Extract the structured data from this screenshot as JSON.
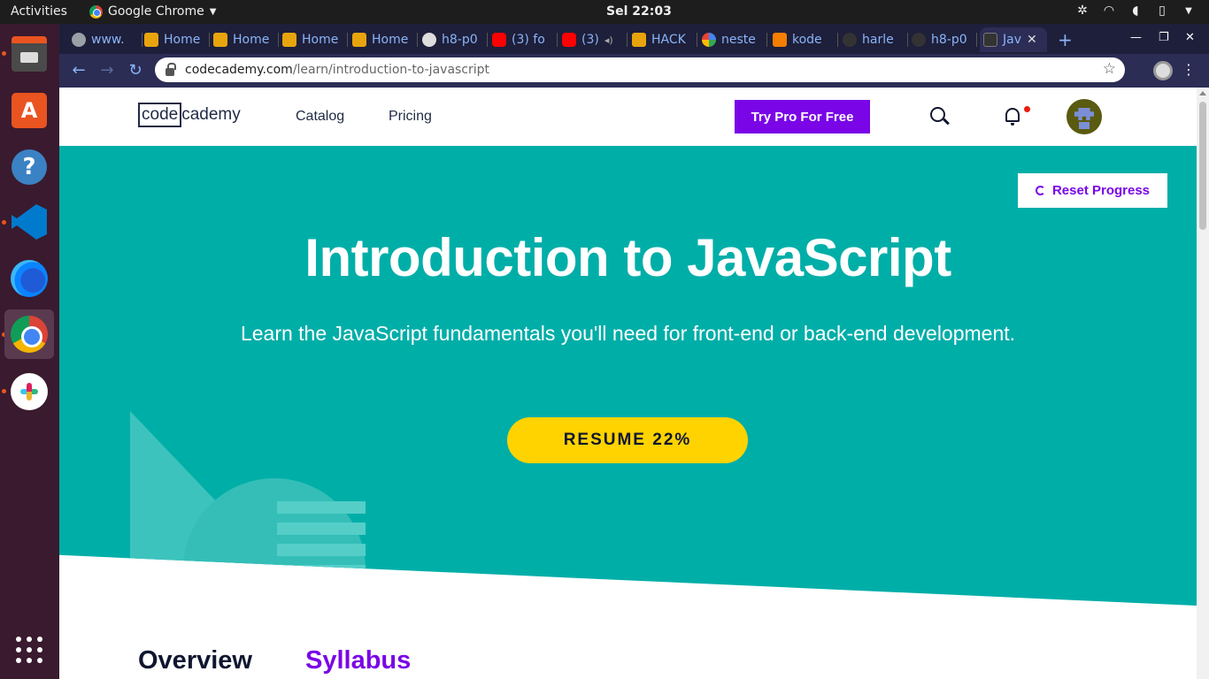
{
  "system": {
    "activities": "Activities",
    "app_name": "Google Chrome",
    "clock": "Sel 22:03"
  },
  "dock": {
    "items": [
      "files",
      "software",
      "help",
      "vscode",
      "firefox",
      "chrome",
      "slack",
      "show-apps"
    ]
  },
  "browser": {
    "tabs": [
      {
        "title": "www.",
        "icon": "globe-icon"
      },
      {
        "title": "Home",
        "icon": "cat-icon"
      },
      {
        "title": "Home",
        "icon": "cat-icon"
      },
      {
        "title": "Home",
        "icon": "cat-icon"
      },
      {
        "title": "Home",
        "icon": "cat-icon"
      },
      {
        "title": "h8-p0",
        "icon": "github-icon"
      },
      {
        "title": "(3) fo",
        "icon": "youtube-icon"
      },
      {
        "title": "(3)",
        "icon": "youtube-icon"
      },
      {
        "title": "HACK",
        "icon": "cat-icon"
      },
      {
        "title": "neste",
        "icon": "google-icon"
      },
      {
        "title": "kode",
        "icon": "blogger-icon"
      },
      {
        "title": "harle",
        "icon": "github-icon"
      },
      {
        "title": "h8-p0",
        "icon": "github-icon"
      },
      {
        "title": "Jav",
        "icon": "codecademy-icon"
      }
    ],
    "url_host": "codecademy.com",
    "url_path": "/learn/introduction-to-javascript"
  },
  "header": {
    "logo_code": "code",
    "logo_cademy": "cademy",
    "nav_catalog": "Catalog",
    "nav_pricing": "Pricing",
    "try_pro": "Try Pro For Free"
  },
  "hero": {
    "reset_label": "Reset Progress",
    "title": "Introduction to JavaScript",
    "subtitle": "Learn the JavaScript fundamentals you'll need for front-end or back-end development.",
    "resume_label": "RESUME 22%"
  },
  "content_tabs": {
    "overview": "Overview",
    "syllabus": "Syllabus"
  },
  "colors": {
    "hero_bg": "#00aea8",
    "accent_purple": "#7a05e6",
    "resume_yellow": "#ffd300",
    "navy": "#10162f"
  }
}
